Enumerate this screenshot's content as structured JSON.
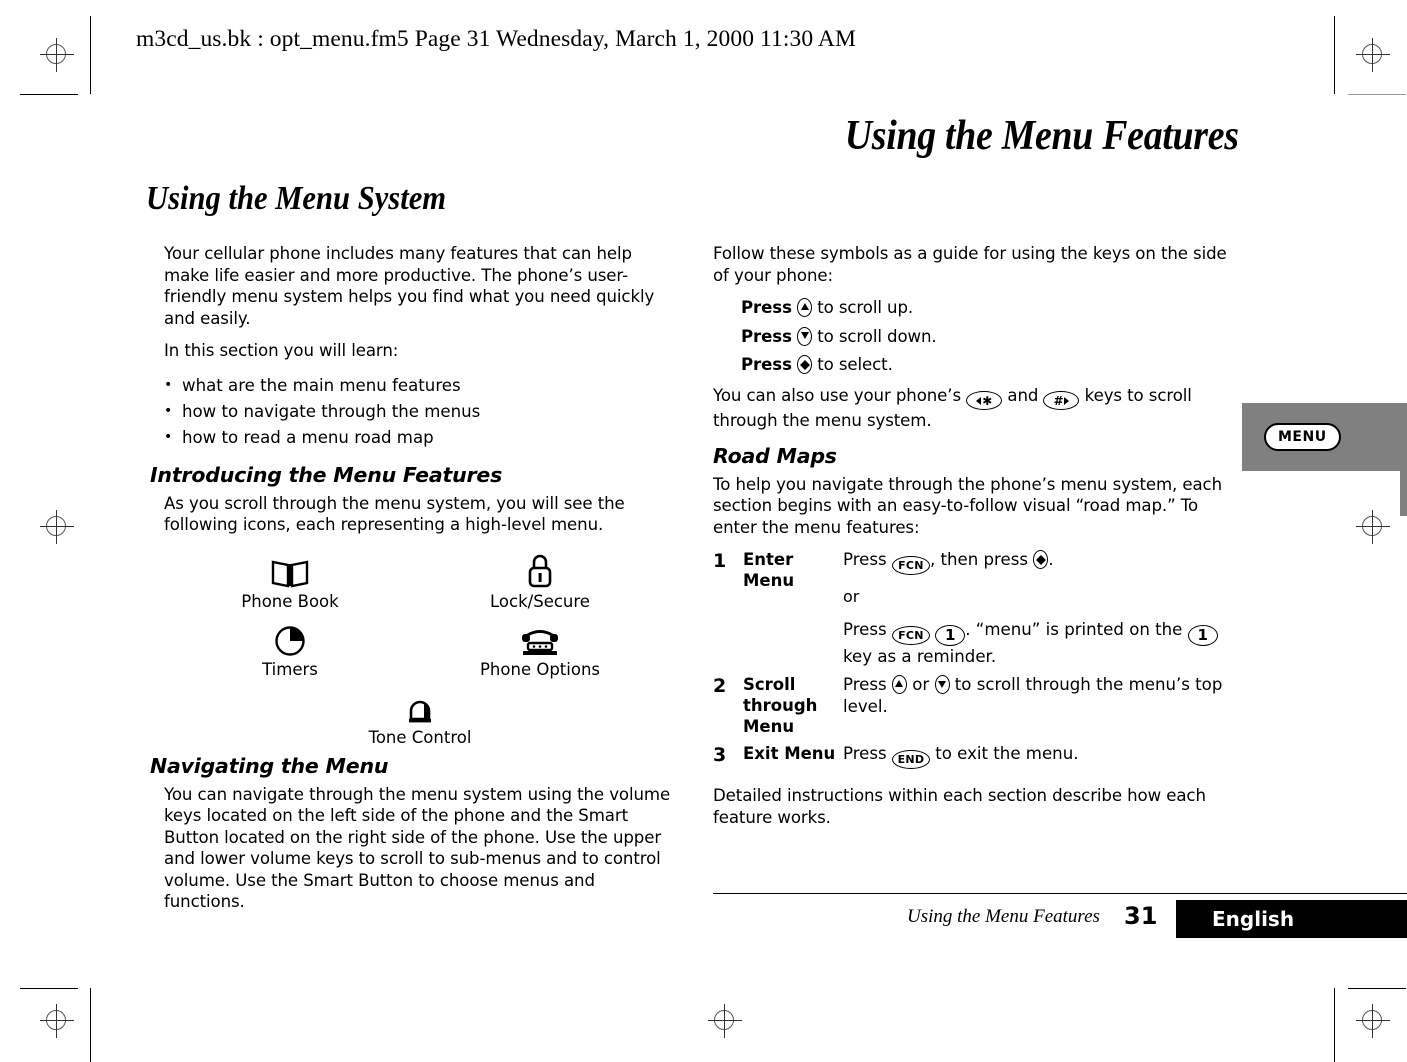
{
  "header": {
    "file_info": "m3cd_us.bk : opt_menu.fm5  Page 31  Wednesday, March 1, 2000  11:30 AM"
  },
  "chapter_title": "Using the Menu Features",
  "section_title": "Using the Menu System",
  "left_column": {
    "intro_paragraph": "Your cellular phone includes many features that can help make life easier and more productive. The phone’s user-friendly menu system helps you find what you need quickly and easily.",
    "learn_lead": "In this section you will learn:",
    "bullets": [
      "what are the main menu features",
      "how to navigate through the menus",
      "how to read a menu road map"
    ],
    "introducing_heading": "Introducing the Menu Features",
    "introducing_paragraph": "As you scroll through the menu system, you will see the following icons, each representing a high-level menu.",
    "menu_icons": [
      {
        "icon": "book-icon",
        "label": "Phone Book"
      },
      {
        "icon": "padlock-icon",
        "label": "Lock/Secure"
      },
      {
        "icon": "clock-icon",
        "label": "Timers"
      },
      {
        "icon": "telephone-icon",
        "label": "Phone Options"
      },
      {
        "icon": "bell-icon",
        "label": "Tone Control"
      }
    ],
    "navigating_heading": "Navigating the Menu",
    "navigating_paragraph": "You can navigate through the menu system using the volume keys located on the left side of the phone and the Smart Button located on the right side of the phone. Use the upper and lower volume keys to scroll to sub-menus and to control volume. Use the Smart Button to choose menus and functions."
  },
  "right_column": {
    "symbols_lead": "Follow these symbols as a guide for using the keys on the side of your phone:",
    "press_lines": [
      {
        "bold": "Press",
        "key": "scroll-up-key",
        "rest": "to scroll up."
      },
      {
        "bold": "Press",
        "key": "scroll-down-key",
        "rest": "to scroll down."
      },
      {
        "bold": "Press",
        "key": "select-key",
        "rest": "to select."
      }
    ],
    "also_use_prefix": "You can also use your phone’s",
    "also_use_middle": "and",
    "also_use_suffix": "keys to scroll through the menu system.",
    "road_maps_heading": "Road Maps",
    "road_maps_paragraph": "To help you navigate through the phone’s menu system, each section begins with an easy-to-follow visual “road map.” To enter the menu features:",
    "steps": [
      {
        "number": "1",
        "title": "Enter Menu",
        "line1_prefix": "Press",
        "line1_key": "FCN",
        "line1_middle": ", then press",
        "line1_suffix": ".",
        "or_label": "or",
        "line2_prefix": "Press",
        "line2_key1": "FCN",
        "line2_key2": "1",
        "line2_middle": ". “menu” is printed on the",
        "line2_suffix": "key as a reminder."
      },
      {
        "number": "2",
        "title": "Scroll through Menu",
        "line1_prefix": "Press",
        "line1_middle": "or",
        "line1_suffix": "to scroll through the menu’s top level."
      },
      {
        "number": "3",
        "title": "Exit Menu",
        "line1_prefix": "Press",
        "line1_key": "END",
        "line1_suffix": "to exit the menu."
      }
    ],
    "closing_paragraph": "Detailed instructions within each section describe how each feature works."
  },
  "side_tab": {
    "label": "MENU",
    "background_color": "#808080"
  },
  "footer": {
    "running_head": "Using the Menu Features",
    "page_number": "31",
    "language": "English",
    "language_bar_color": "#000000"
  }
}
